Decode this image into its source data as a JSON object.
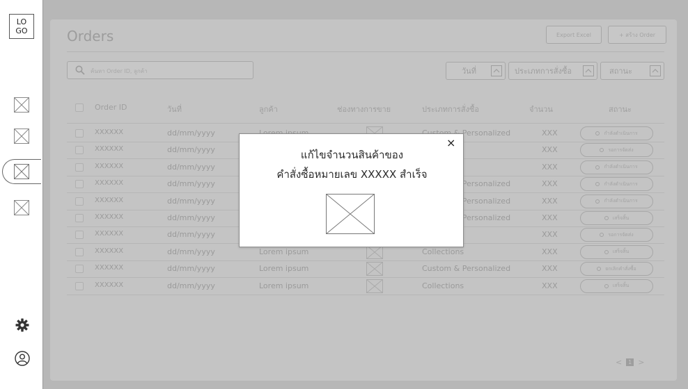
{
  "sidebar": {
    "logo": "LO\nGO",
    "logo_line1": "LO",
    "logo_line2": "GO",
    "nav_items": [
      "image-placeholder",
      "image-placeholder",
      "image-placeholder",
      "image-placeholder"
    ],
    "active_index": 2,
    "bottom_icons": [
      "gear-icon",
      "user-icon"
    ]
  },
  "header": {
    "title": "Orders",
    "export_button": "Export Excel",
    "create_button": "+ สร้าง Order"
  },
  "toolbar": {
    "search_placeholder": "ค้นหา Order ID, ลูกค้า",
    "filters": [
      "วันที่",
      "ประเภทการสั่งซื้อ",
      "สถานะ"
    ]
  },
  "table": {
    "columns": [
      "Order ID",
      "วันที่",
      "ลูกค้า",
      "ช่องทางการขาย",
      "ประเภทการสั่งซื้อ",
      "จำนวน",
      "สถานะ"
    ],
    "rows": [
      {
        "id": "XXXXXX",
        "date": "dd/mm/yyyy",
        "customer": "Lorem ipsum",
        "type": "Custom & Personalized",
        "qty": "XXX",
        "status": "กำลังดำเนินการ"
      },
      {
        "id": "XXXXXX",
        "date": "dd/mm/yyyy",
        "customer": "Lorem ipsum",
        "type": "Collections",
        "qty": "XXX",
        "status": "รอการจัดส่ง"
      },
      {
        "id": "XXXXXX",
        "date": "dd/mm/yyyy",
        "customer": "Lorem ipsum",
        "type": "Collections",
        "qty": "XXX",
        "status": "กำลังดำเนินการ"
      },
      {
        "id": "XXXXXX",
        "date": "dd/mm/yyyy",
        "customer": "Lorem ipsum",
        "type": "Custom & Personalized",
        "qty": "XXX",
        "status": "กำลังดำเนินการ"
      },
      {
        "id": "XXXXXX",
        "date": "dd/mm/yyyy",
        "customer": "Lorem ipsum",
        "type": "Custom & Personalized",
        "qty": "XXX",
        "status": "กำลังดำเนินการ"
      },
      {
        "id": "XXXXXX",
        "date": "dd/mm/yyyy",
        "customer": "Lorem ipsum",
        "type": "Custom & Personalized",
        "qty": "XXX",
        "status": "เสร็จสิ้น"
      },
      {
        "id": "XXXXXX",
        "date": "dd/mm/yyyy",
        "customer": "Lorem ipsum",
        "type": "Collections",
        "qty": "XXX",
        "status": "รอการจัดส่ง"
      },
      {
        "id": "XXXXXX",
        "date": "dd/mm/yyyy",
        "customer": "Lorem ipsum",
        "type": "Collections",
        "qty": "XXX",
        "status": "เสร็จสิ้น"
      },
      {
        "id": "XXXXXX",
        "date": "dd/mm/yyyy",
        "customer": "Lorem ipsum",
        "type": "Custom & Personalized",
        "qty": "XXX",
        "status": "ยกเลิกคำสั่งซื้อ"
      },
      {
        "id": "XXXXXX",
        "date": "dd/mm/yyyy",
        "customer": "Lorem ipsum",
        "type": "Collections",
        "qty": "XXX",
        "status": "เสร็จสิ้น"
      }
    ]
  },
  "pagination": {
    "prev": "<",
    "current": "1",
    "next": ">"
  },
  "modal": {
    "line1": "แก้ไขจำนวนสินค้าของ",
    "line2": "คำสั่งซื้อหมายเลข XXXXX สำเร็จ",
    "close": "×"
  },
  "colors": {
    "overlay": "#b7b7b7",
    "panel": "#c4c4c4",
    "modal_bg": "#ffffff",
    "text_dark": "#2a2a2a"
  }
}
